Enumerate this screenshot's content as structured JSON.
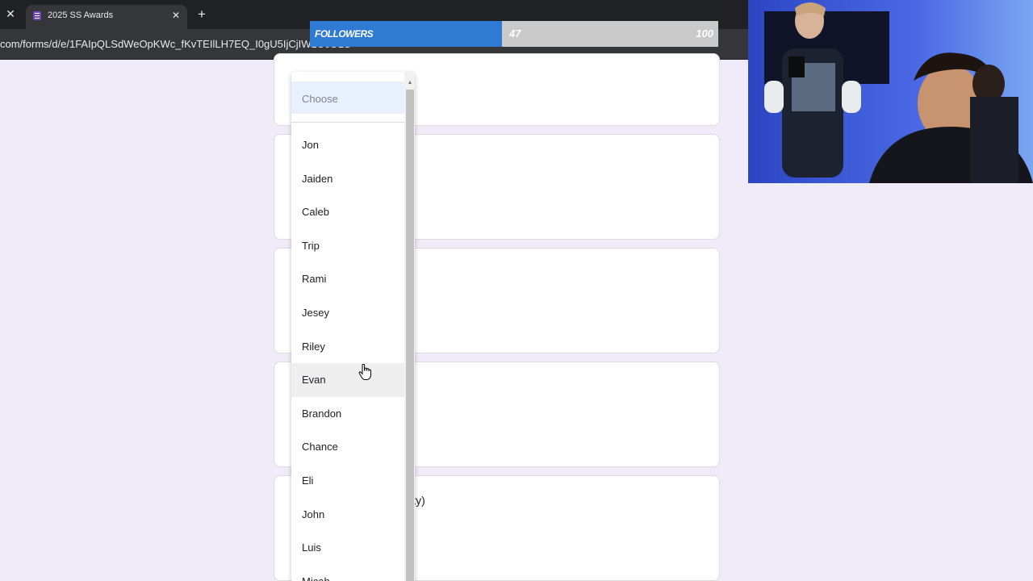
{
  "browser": {
    "tab_title": "2025 SS Awards",
    "url": "com/forms/d/e/1FAIpQLSdWeOpKWc_fKvTEIlLH7EQ_I0gU5IjCjIW1UcOLS",
    "close_glyph": "✕",
    "new_tab_glyph": "+"
  },
  "followers_overlay": {
    "label": "FOLLOWERS",
    "count": "47",
    "goal": "100",
    "progress_fraction": 0.47,
    "fill_color": "#2f7bd4"
  },
  "form": {
    "partial_question_text": "City)"
  },
  "dropdown": {
    "placeholder": "Choose",
    "options": [
      "Jon",
      "Jaiden",
      "Caleb",
      "Trip",
      "Rami",
      "Jesey",
      "Riley",
      "Evan",
      "Brandon",
      "Chance",
      "Eli",
      "John",
      "Luis",
      "Micah"
    ],
    "hovered_option": "Evan"
  },
  "colors": {
    "page_background": "#f0ebf8",
    "form_accent": "#7248b9"
  }
}
